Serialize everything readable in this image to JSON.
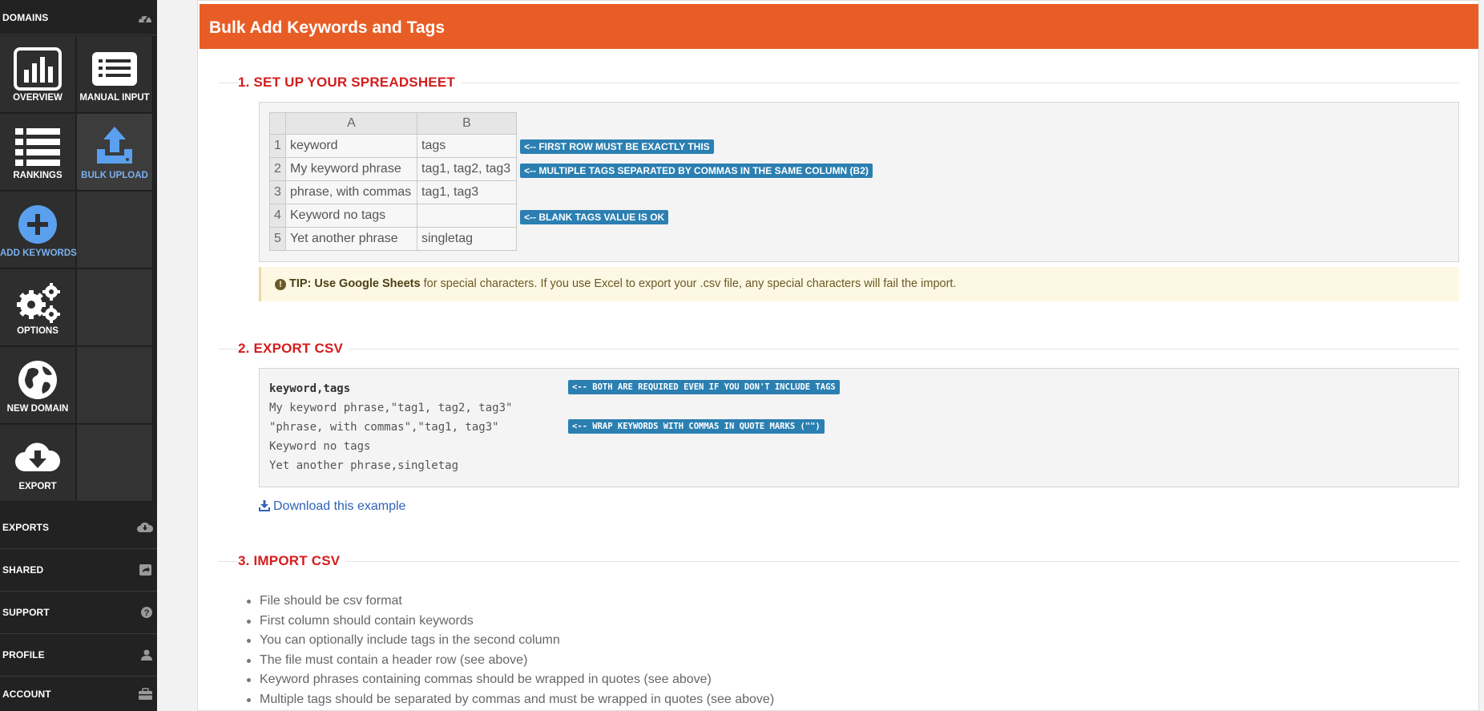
{
  "sidebar": {
    "top_label": "DOMAINS",
    "tiles": {
      "overview": "OVERVIEW",
      "manual_input": "MANUAL INPUT",
      "rankings": "RANKINGS",
      "bulk_upload": "BULK UPLOAD",
      "add_keywords": "ADD KEYWORDS",
      "options": "OPTIONS",
      "new_domain": "NEW DOMAIN",
      "export": "EXPORT"
    },
    "active_tile": "bulk_upload",
    "bottom_items": [
      {
        "label": "EXPORTS",
        "icon": "cloud-download-icon"
      },
      {
        "label": "SHARED",
        "icon": "share-icon"
      },
      {
        "label": "SUPPORT",
        "icon": "question-circle-icon"
      },
      {
        "label": "PROFILE",
        "icon": "user-icon"
      },
      {
        "label": "ACCOUNT",
        "icon": "briefcase-icon"
      }
    ]
  },
  "panel": {
    "title": "Bulk Add Keywords and Tags",
    "accent_color": "#e85d25"
  },
  "section1": {
    "title": "1. SET UP YOUR SPREADSHEET",
    "sheet": {
      "col_headers": [
        "A",
        "B"
      ],
      "rows": [
        {
          "num": "1",
          "a": "keyword",
          "b": "tags"
        },
        {
          "num": "2",
          "a": "My keyword phrase",
          "b": "tag1, tag2, tag3"
        },
        {
          "num": "3",
          "a": "phrase, with commas",
          "b": "tag1, tag3"
        },
        {
          "num": "4",
          "a": "Keyword no tags",
          "b": ""
        },
        {
          "num": "5",
          "a": "Yet another phrase",
          "b": "singletag"
        }
      ]
    },
    "notes": [
      "<-- FIRST ROW MUST BE EXACTLY THIS",
      "<-- MULTIPLE TAGS SEPARATED BY COMMAS IN THE SAME COLUMN (B2)",
      "<-- BLANK TAGS VALUE IS OK"
    ],
    "tip": {
      "bold": "TIP: Use Google Sheets",
      "text": " for special characters. If you use Excel to export your .csv file, any special characters will fail the import."
    }
  },
  "section2": {
    "title": "2. EXPORT CSV",
    "lines": [
      "keyword,tags",
      "My keyword phrase,\"tag1, tag2, tag3\"",
      "\"phrase, with commas\",\"tag1, tag3\"",
      "Keyword no tags",
      "Yet another phrase,singletag"
    ],
    "notes": [
      "<-- BOTH ARE REQUIRED EVEN IF YOU DON'T INCLUDE TAGS",
      "<-- WRAP KEYWORDS WITH COMMAS IN QUOTE MARKS (\"\")"
    ],
    "download_link": "Download this example"
  },
  "section3": {
    "title": "3. IMPORT CSV",
    "items": [
      "File should be csv format",
      "First column should contain keywords",
      "You can optionally include tags in the second column",
      "The file must contain a header row (see above)",
      "Keyword phrases containing commas should be wrapped in quotes (see above)",
      "Multiple tags should be separated by commas and must be wrapped in quotes (see above)"
    ]
  }
}
